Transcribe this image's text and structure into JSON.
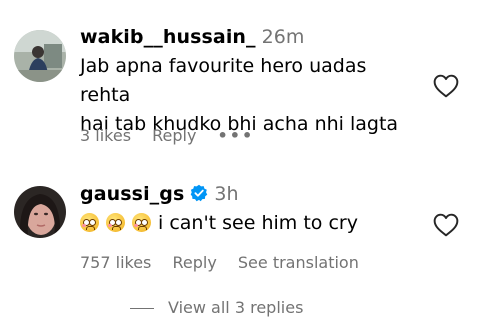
{
  "comments": [
    {
      "username": "wakib__hussain_",
      "time": "26m",
      "verified": false,
      "text_lines": [
        "Jab apna favourite hero uadas rehta",
        "hai tab khudko bhi acha nhi lagta"
      ],
      "likes": "3 likes",
      "reply": "Reply",
      "more": "•••",
      "like_icon": "heart-outline-icon"
    },
    {
      "username": "gaussi_gs",
      "time": "3h",
      "verified": true,
      "emojis": [
        "pleading-face",
        "pleading-face",
        "pleading-face"
      ],
      "text": "i can't see him to cry",
      "likes": "757 likes",
      "reply": "Reply",
      "translate": "See translation",
      "like_icon": "heart-outline-icon"
    }
  ],
  "view_replies": "View all 3 replies",
  "colors": {
    "secondary_text": "#737373",
    "verified_blue": "#0095f6"
  }
}
